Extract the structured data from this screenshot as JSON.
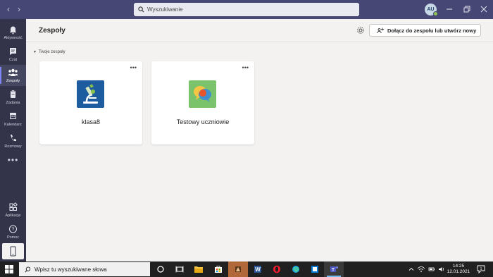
{
  "titlebar": {
    "search_placeholder": "Wyszukiwanie",
    "avatar_initials": "AU"
  },
  "rail": {
    "items": [
      {
        "label": "Aktywność",
        "icon": "bell-icon"
      },
      {
        "label": "Czat",
        "icon": "chat-icon"
      },
      {
        "label": "Zespoły",
        "icon": "teams-icon"
      },
      {
        "label": "Zadania",
        "icon": "assignments-icon"
      },
      {
        "label": "Kalendarz",
        "icon": "calendar-icon"
      },
      {
        "label": "Rozmowy",
        "icon": "phone-icon"
      }
    ],
    "more": "•••",
    "bottom": [
      {
        "label": "Aplikacje",
        "icon": "apps-icon"
      },
      {
        "label": "Pomoc",
        "icon": "help-icon"
      }
    ],
    "active": "Zespoły"
  },
  "header": {
    "title": "Zespoły",
    "join_label": "Dołącz do zespołu lub utwórz nowy"
  },
  "section": {
    "label": "Twoje zespoły"
  },
  "teams": [
    {
      "name": "klasa8",
      "icon": "microscope-icon"
    },
    {
      "name": "Testowy uczniowie",
      "icon": "speech-bubbles-icon"
    }
  ],
  "card_more": "•••",
  "taskbar": {
    "search_placeholder": "Wpisz tu wyszukiwane słowa",
    "time": "14:25",
    "date": "12.01.2021"
  },
  "colors": {
    "titlebar": "#464775",
    "rail": "#33344a",
    "accent": "#7f85f5",
    "background": "#f3f2f1",
    "taskbar": "#202020"
  }
}
